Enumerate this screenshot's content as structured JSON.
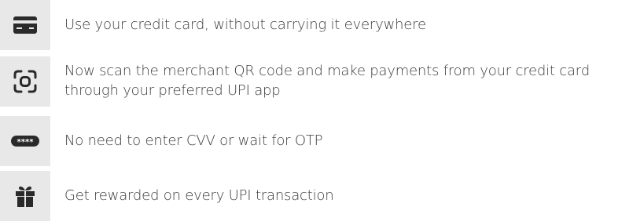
{
  "features": [
    {
      "icon": "credit-card-icon",
      "text": "Use your credit card, without carrying it everywhere"
    },
    {
      "icon": "qr-scan-icon",
      "text": "Now scan the merchant QR code and make payments from your credit card through your preferred UPI app"
    },
    {
      "icon": "masked-cvv-icon",
      "text": "No need to enter CVV or wait for OTP",
      "icon_glyph": "****"
    },
    {
      "icon": "gift-icon",
      "text": "Get rewarded on every UPI transaction"
    }
  ],
  "colors": {
    "icon_background": "#e8e8e8",
    "icon_foreground": "#2a2a2a",
    "text": "#3c3c3c"
  }
}
